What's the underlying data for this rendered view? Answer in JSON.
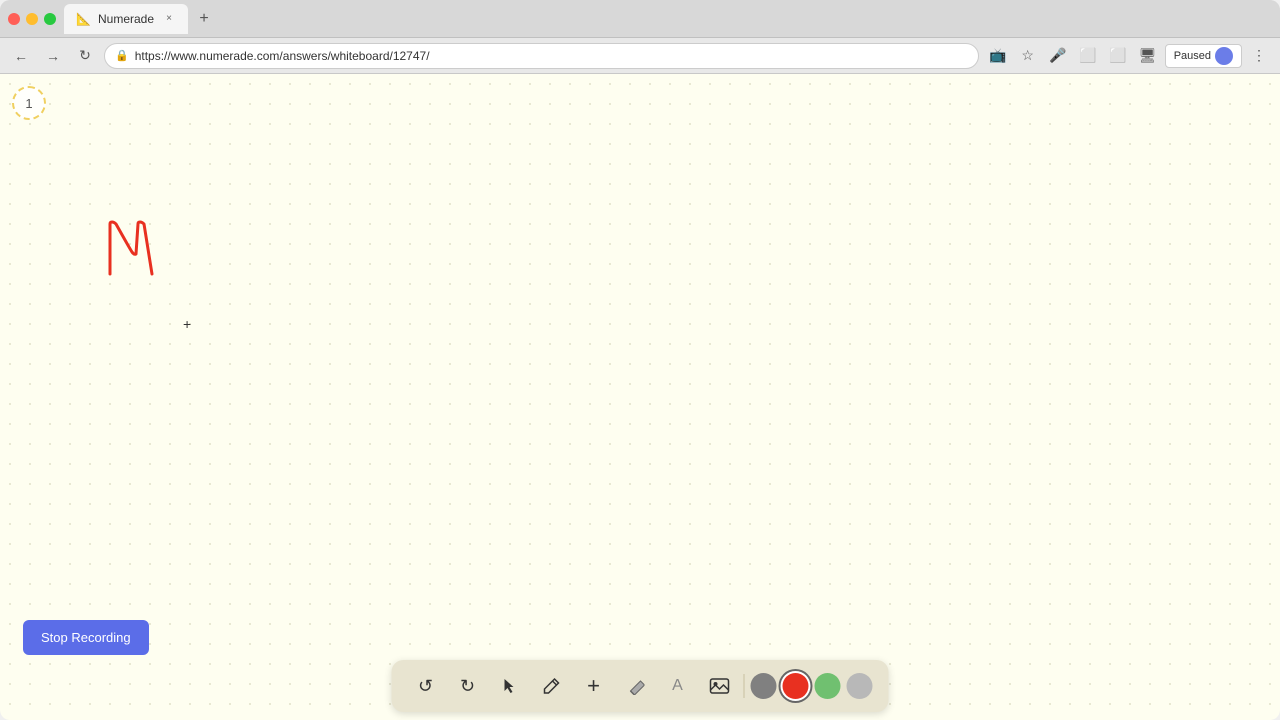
{
  "browser": {
    "title": "Numerade",
    "url": "https://www.numerade.com/answers/whiteboard/12747/",
    "tab_label": "Numerade",
    "paused_label": "Paused"
  },
  "page": {
    "page_number": "1"
  },
  "toolbar": {
    "stop_recording_label": "Stop Recording",
    "tools": [
      {
        "name": "undo",
        "icon": "↺",
        "label": "Undo"
      },
      {
        "name": "redo",
        "icon": "↻",
        "label": "Redo"
      },
      {
        "name": "select",
        "icon": "↖",
        "label": "Select"
      },
      {
        "name": "pen",
        "icon": "✏",
        "label": "Pen"
      },
      {
        "name": "add",
        "icon": "+",
        "label": "Add"
      },
      {
        "name": "eraser",
        "icon": "◪",
        "label": "Eraser"
      },
      {
        "name": "text",
        "icon": "A",
        "label": "Text"
      },
      {
        "name": "image",
        "icon": "🖼",
        "label": "Image"
      }
    ],
    "colors": [
      {
        "name": "gray",
        "value": "#808080"
      },
      {
        "name": "red",
        "value": "#e83020"
      },
      {
        "name": "green",
        "value": "#70c070"
      },
      {
        "name": "light-gray",
        "value": "#b0b0b0"
      }
    ]
  },
  "nav": {
    "back_label": "Back",
    "forward_label": "Forward",
    "refresh_label": "Refresh"
  }
}
